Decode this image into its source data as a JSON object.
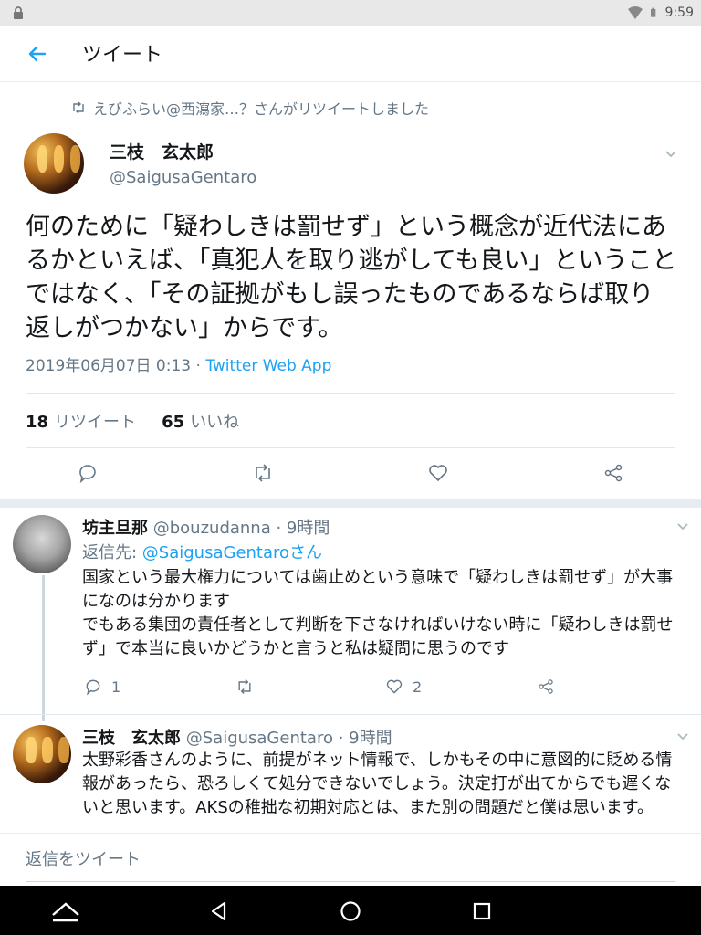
{
  "status_bar": {
    "time": "9:59",
    "icons": [
      "lock-icon",
      "wifi-icon",
      "battery-icon"
    ]
  },
  "app_bar": {
    "title": "ツイート",
    "back_icon": "arrow-left-icon"
  },
  "retweet_context": {
    "text": "えびふらい@西瀉家…？さんがリツイートしました"
  },
  "main_tweet": {
    "display_name": "三枝　玄太郎",
    "handle": "@SaigusaGentaro",
    "text": "何のために「疑わしきは罰せず」という概念が近代法にあるかといえば、「真犯人を取り逃がしても良い」ということではなく、「その証拠がもし誤ったものであるならば取り返しがつかない」からです。",
    "timestamp": "2019年06月07日 0:13 · ",
    "source": "Twitter Web App",
    "retweets_count": "18",
    "retweets_label": "リツイート",
    "likes_count": "65",
    "likes_label": "いいね"
  },
  "replies": [
    {
      "display_name": "坊主旦那",
      "handle_time": "@bouzudanna · 9時間",
      "reply_to_prefix": "返信先: ",
      "reply_to_handle": "@SaigusaGentaro",
      "reply_to_suffix": "さん",
      "text": "国家という最大権力については歯止めという意味で「疑わしきは罰せず」が大事になのは分かります\nでもある集団の責任者として判断を下さなければいけない時に「疑わしきは罰せず」で本当に良いかどうかと言うと私は疑問に思うのです",
      "reply_count": "1",
      "retweet_count": "",
      "like_count": "2"
    },
    {
      "display_name": "三枝　玄太郎",
      "handle_time": "@SaigusaGentaro · 9時間",
      "text": "太野彩香さんのように、前提がネット情報で、しかもその中に意図的に貶める情報があったら、恐ろしくて処分できないでしょう。決定打が出てからでも遅くないと思います。AKSの稚拙な初期対応とは、また別の問題だと僕は思います。"
    }
  ],
  "reply_bar": {
    "placeholder": "返信をツイート"
  },
  "colors": {
    "accent": "#1da1f2",
    "secondary_text": "#657786",
    "primary_text": "#14171a"
  }
}
